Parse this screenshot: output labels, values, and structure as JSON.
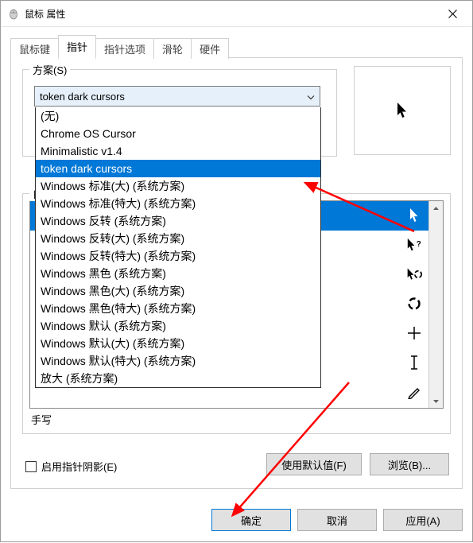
{
  "window": {
    "title": "鼠标 属性"
  },
  "tabs": {
    "t0": "鼠标键",
    "t1": "指针",
    "t2": "指针选项",
    "t3": "滑轮",
    "t4": "硬件"
  },
  "scheme": {
    "label": "方案(S)",
    "selected": "token dark cursors",
    "options": [
      "(无)",
      "Chrome OS Cursor",
      "Minimalistic v1.4",
      "token dark cursors",
      "Windows 标准(大) (系统方案)",
      "Windows 标准(特大) (系统方案)",
      "Windows 反转 (系统方案)",
      "Windows 反转(大) (系统方案)",
      "Windows 反转(特大) (系统方案)",
      "Windows 黑色 (系统方案)",
      "Windows 黑色(大) (系统方案)",
      "Windows 黑色(特大) (系统方案)",
      "Windows 默认 (系统方案)",
      "Windows 默认(大) (系统方案)",
      "Windows 默认(特大) (系统方案)",
      "放大 (系统方案)"
    ],
    "selectedIndex": 3
  },
  "customize": {
    "label": "自",
    "rows": [
      {
        "label": "",
        "icon": "arrow"
      },
      {
        "label": "",
        "icon": "help"
      },
      {
        "label": "",
        "icon": "busy-arrow"
      },
      {
        "label": "",
        "icon": "busy"
      },
      {
        "label": "",
        "icon": "precision"
      },
      {
        "label": "",
        "icon": "text"
      },
      {
        "label": "",
        "icon": "pen"
      },
      {
        "label": "",
        "icon": "unavailable"
      }
    ],
    "handwrite": "手写",
    "selectedIndex": 0,
    "buttonDefault": "使用默认值(F)",
    "buttonBrowse": "浏览(B)..."
  },
  "checkbox": {
    "label": "启用指针阴影(E)",
    "checked": false
  },
  "footer": {
    "ok": "确定",
    "cancel": "取消",
    "apply": "应用(A)"
  }
}
